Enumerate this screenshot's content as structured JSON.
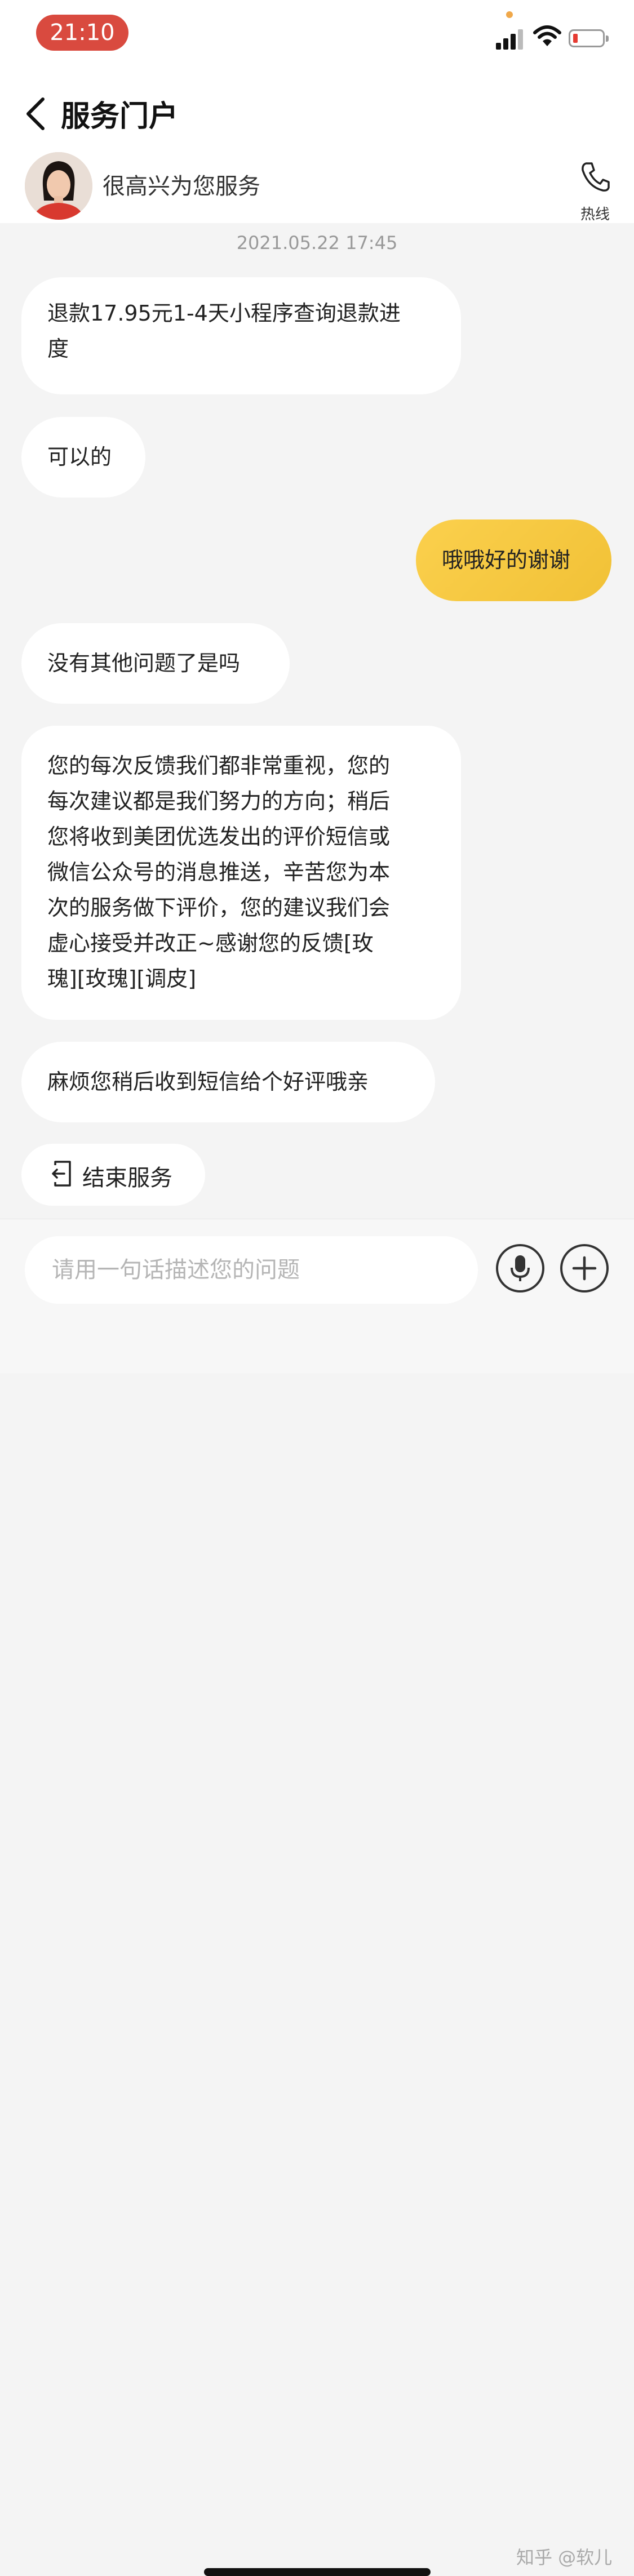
{
  "status_bar": {
    "time": "21:10"
  },
  "nav": {
    "title": "服务门户"
  },
  "agent": {
    "greeting": "很高兴为您服务",
    "hotline_label": "热线"
  },
  "chat": {
    "timestamp": "2021.05.22 17:45",
    "messages": [
      {
        "from": "agent",
        "lines": [
          "退款17.95元1-4天小程序查询退款进",
          "度"
        ]
      },
      {
        "from": "agent",
        "lines": [
          "可以的"
        ]
      },
      {
        "from": "user",
        "lines": [
          "哦哦好的谢谢"
        ]
      },
      {
        "from": "agent",
        "lines": [
          "没有其他问题了是吗"
        ]
      },
      {
        "from": "agent",
        "lines": [
          "您的每次反馈我们都非常重视，您的",
          "每次建议都是我们努力的方向；稍后",
          "您将收到美团优选发出的评价短信或",
          "微信公众号的消息推送，辛苦您为本",
          "次的服务做下评价，您的建议我们会",
          "虚心接受并改正~感谢您的反馈[玫",
          "瑰][玫瑰][调皮]"
        ]
      },
      {
        "from": "agent",
        "lines": [
          "麻烦您稍后收到短信给个好评哦亲"
        ]
      }
    ]
  },
  "end_service": {
    "label": "结束服务"
  },
  "composer": {
    "placeholder": "请用一句话描述您的问题"
  },
  "watermark": "知乎 @软儿",
  "colors": {
    "time_pill": "#d94a3f",
    "user_bubble": "#f5c63e",
    "background": "#f4f4f4"
  },
  "icons": [
    "back-arrow-icon",
    "phone-icon",
    "exit-icon",
    "microphone-icon",
    "plus-icon"
  ]
}
